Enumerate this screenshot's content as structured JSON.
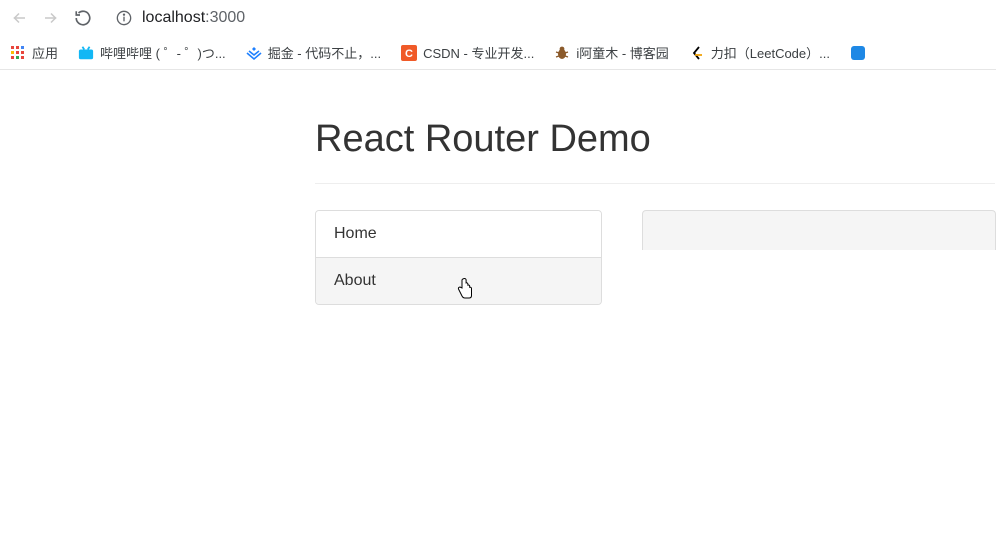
{
  "toolbar": {
    "url_host": "localhost",
    "url_port": ":3000"
  },
  "bookmarks": {
    "apps_label": "应用",
    "items": [
      {
        "label": "哔哩哔哩 ( ゜- ゜)つ..."
      },
      {
        "label": "掘金 - 代码不止，..."
      },
      {
        "label": "CSDN - 专业开发..."
      },
      {
        "label": "i阿童木 - 博客园"
      },
      {
        "label": "力扣（LeetCode）..."
      }
    ]
  },
  "page": {
    "title": "React Router Demo",
    "nav": [
      {
        "label": "Home"
      },
      {
        "label": "About"
      }
    ]
  }
}
